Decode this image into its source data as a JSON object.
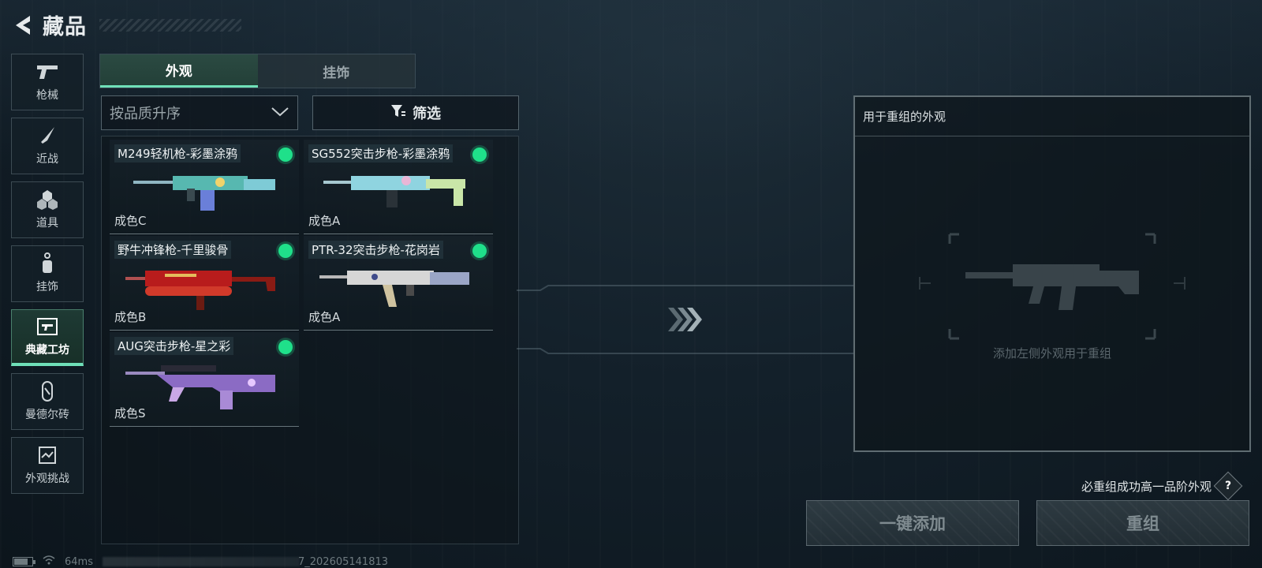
{
  "header": {
    "title": "藏品"
  },
  "sidebar": {
    "items": [
      {
        "label": "枪械",
        "icon": "pistol-icon"
      },
      {
        "label": "近战",
        "icon": "knife-icon"
      },
      {
        "label": "道具",
        "icon": "grenade-icon"
      },
      {
        "label": "挂饰",
        "icon": "charm-icon"
      },
      {
        "label": "典藏工坊",
        "icon": "workshop-icon",
        "active": true
      },
      {
        "label": "曼德尔砖",
        "icon": "brick-icon"
      },
      {
        "label": "外观挑战",
        "icon": "challenge-icon"
      }
    ]
  },
  "tabs": [
    {
      "label": "外观",
      "active": true
    },
    {
      "label": "挂饰",
      "active": false
    }
  ],
  "sort": {
    "selected": "按品质升序"
  },
  "filter": {
    "label": "筛选"
  },
  "items": [
    {
      "name": "M249轻机枪-彩墨涂鸦",
      "grade": "成色C",
      "status_color": "#1fe08a"
    },
    {
      "name": "SG552突击步枪-彩墨涂鸦",
      "grade": "成色A",
      "status_color": "#1fe08a"
    },
    {
      "name": "野牛冲锋枪-千里骏骨",
      "grade": "成色B",
      "status_color": "#1fe08a"
    },
    {
      "name": "PTR-32突击步枪-花岗岩",
      "grade": "成色A",
      "status_color": "#1fe08a"
    },
    {
      "name": "AUG突击步枪-星之彩",
      "grade": "成色S",
      "status_color": "#1fe08a"
    }
  ],
  "recombine": {
    "header": "用于重组的外观",
    "placeholder": "添加左侧外观用于重组",
    "guarantee": "必重组成功高一品阶外观",
    "add_all_label": "一键添加",
    "recombine_label": "重组"
  },
  "status": {
    "ping": "64ms",
    "build": "7_202605141813"
  },
  "colors": {
    "accent": "#6fe0b8",
    "status_dot": "#1fe08a"
  }
}
